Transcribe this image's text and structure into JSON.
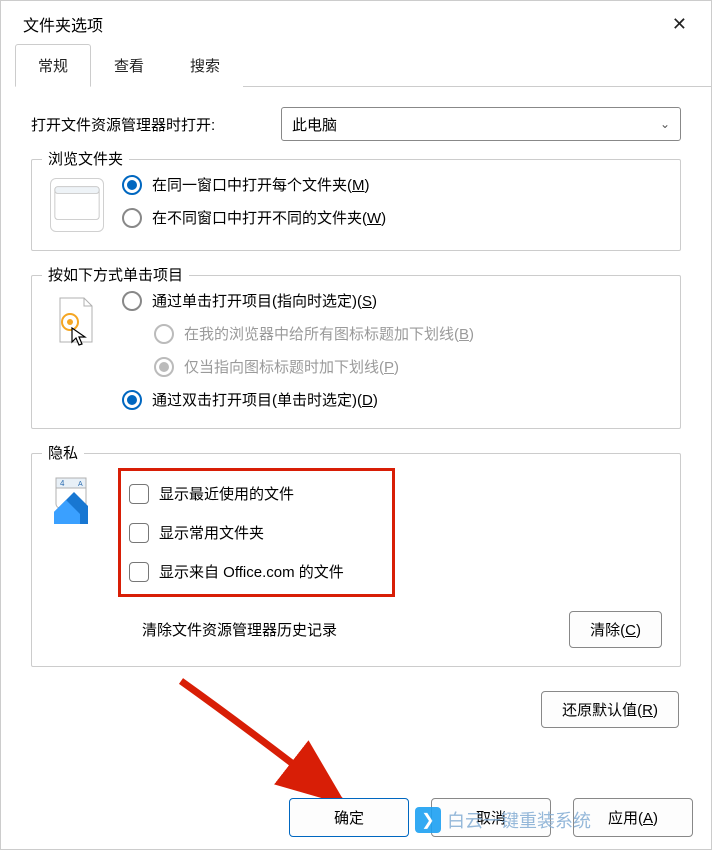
{
  "title": "文件夹选项",
  "tabs": {
    "general": "常规",
    "view": "查看",
    "search": "搜索"
  },
  "open": {
    "label": "打开文件资源管理器时打开:",
    "selected": "此电脑"
  },
  "browse": {
    "legend": "浏览文件夹",
    "same_html": "在同一窗口中打开每个文件夹(<u>M</u>)",
    "diff_html": "在不同窗口中打开不同的文件夹(<u>W</u>)"
  },
  "click": {
    "legend": "按如下方式单击项目",
    "single_html": "通过单击打开项目(指向时选定)(<u>S</u>)",
    "browser_underline_html": "在我的浏览器中给所有图标标题加下划线(<u>B</u>)",
    "point_underline_html": "仅当指向图标标题时加下划线(<u>P</u>)",
    "double_html": "通过双击打开项目(单击时选定)(<u>D</u>)"
  },
  "privacy": {
    "legend": "隐私",
    "recent": "显示最近使用的文件",
    "frequent": "显示常用文件夹",
    "office": "显示来自 Office.com 的文件",
    "history_label": "清除文件资源管理器历史记录",
    "clear_html": "清除(<u>C</u>)"
  },
  "restore_html": "还原默认值(<u>R</u>)",
  "footer": {
    "ok": "确定",
    "cancel_html": "取消",
    "apply_html": "应用(<u>A</u>)"
  },
  "watermark": "白云一键重装系统"
}
